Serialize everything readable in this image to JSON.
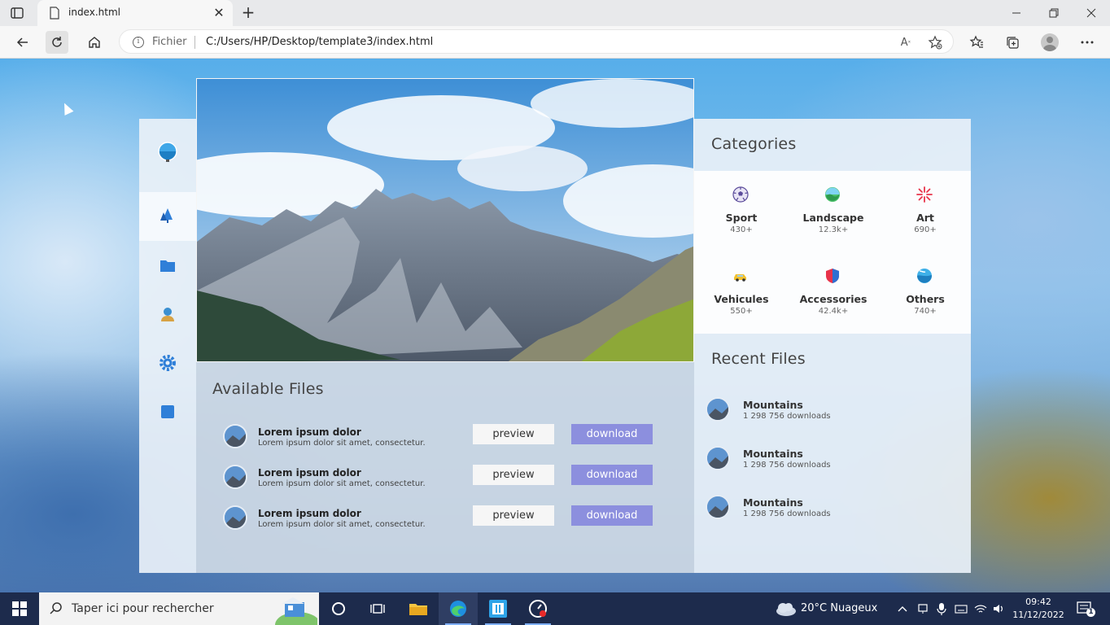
{
  "browser": {
    "tab_title": "index.html",
    "url_scheme": "Fichier",
    "url": "C:/Users/HP/Desktop/template3/index.html"
  },
  "icons": {
    "sidebar": [
      "profile-globe-icon",
      "trees-icon",
      "folder-icon",
      "user-icon",
      "gear-icon",
      "stop-square-icon"
    ],
    "toolbar": [
      "back-icon",
      "reload-icon",
      "home-icon",
      "read-aloud-icon",
      "add-favorite-icon",
      "favorites-icon",
      "collections-icon",
      "profile-icon",
      "more-icon"
    ]
  },
  "colors": {
    "accent": "#8c8fde",
    "taskbar": "#1d2b4c"
  },
  "files": {
    "title": "Available Files",
    "items": [
      {
        "title": "Lorem ipsum dolor",
        "desc": "Lorem ipsum dolor sit amet, consectetur.",
        "preview_label": "preview",
        "download_label": "download"
      },
      {
        "title": "Lorem ipsum dolor",
        "desc": "Lorem ipsum dolor sit amet, consectetur.",
        "preview_label": "preview",
        "download_label": "download"
      },
      {
        "title": "Lorem ipsum dolor",
        "desc": "Lorem ipsum dolor sit amet, consectetur.",
        "preview_label": "preview",
        "download_label": "download"
      }
    ]
  },
  "categories": {
    "title": "Categories",
    "items": [
      {
        "name": "Sport",
        "count": "430+",
        "icon": "soccer-ball-icon"
      },
      {
        "name": "Landscape",
        "count": "12.3k+",
        "icon": "landscape-icon"
      },
      {
        "name": "Art",
        "count": "690+",
        "icon": "firework-icon"
      },
      {
        "name": "Vehicules",
        "count": "550+",
        "icon": "car-icon"
      },
      {
        "name": "Accessories",
        "count": "42.4k+",
        "icon": "shield-icon"
      },
      {
        "name": "Others",
        "count": "740+",
        "icon": "globe-icon"
      }
    ]
  },
  "recent": {
    "title": "Recent Files",
    "items": [
      {
        "title": "Mountains",
        "sub": "1 298 756 downloads"
      },
      {
        "title": "Mountains",
        "sub": "1 298 756 downloads"
      },
      {
        "title": "Mountains",
        "sub": "1 298 756 downloads"
      }
    ]
  },
  "taskbar": {
    "search_placeholder": "Taper ici pour rechercher",
    "weather": "20°C  Nuageux",
    "time": "09:42",
    "date": "11/12/2022",
    "notifications": "1"
  }
}
